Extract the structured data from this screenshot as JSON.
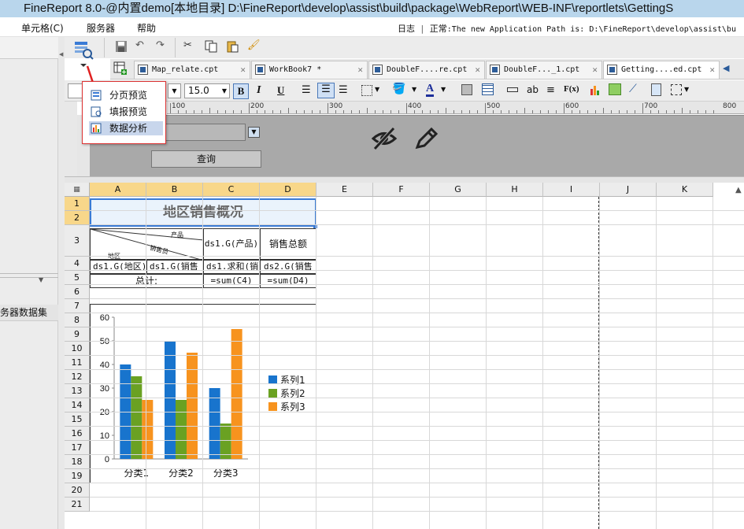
{
  "window": {
    "title": "FineReport 8.0-@内置demo[本地目录]    D:\\FineReport\\develop\\assist\\build\\package\\WebReport\\WEB-INF\\reportlets\\GettingS"
  },
  "menu": {
    "cell": "单元格(C)",
    "server": "服务器",
    "help": "帮助"
  },
  "status": {
    "log": "日志",
    "sep": "|",
    "state": "正常",
    "message": ":The new  Application Path is: D:\\FineReport\\develop\\assist\\bu"
  },
  "left_panel": {
    "dataset_label": "务器数据集"
  },
  "tabs": [
    {
      "label": "Map_relate.cpt"
    },
    {
      "label": "WorkBook7 *"
    },
    {
      "label": "DoubleF....re.cpt"
    },
    {
      "label": "DoubleF..._1.cpt"
    },
    {
      "label": "Getting....ed.cpt"
    }
  ],
  "format": {
    "font_size": "15.0",
    "bold": "B",
    "italic": "I",
    "underline": "U",
    "ab": "ab",
    "fx": "F(x)"
  },
  "ruler_ticks": [
    "100",
    "200",
    "300",
    "400",
    "500",
    "600",
    "700",
    "800"
  ],
  "preview_menu": {
    "page_preview": "分页预览",
    "fill_preview": "填报预览",
    "data_analysis": "数据分析"
  },
  "param": {
    "query_button": "查询"
  },
  "columns": [
    "A",
    "B",
    "C",
    "D",
    "E",
    "F",
    "G",
    "H",
    "I",
    "J",
    "K"
  ],
  "rows": [
    "1",
    "2",
    "3",
    "4",
    "5",
    "6",
    "7",
    "8",
    "9",
    "10",
    "11",
    "12",
    "13",
    "14",
    "15",
    "16",
    "17",
    "18",
    "19",
    "20",
    "21"
  ],
  "cells": {
    "title": "地区销售概况",
    "diag_product": "产品",
    "diag_sales": "销售员",
    "diag_region": "地区",
    "c3": "ds1.G(产品)",
    "d3": "销售总额",
    "a4": "ds1.G(地区)",
    "b4": "ds1.G(销售",
    "c4": "ds1.求和(销",
    "d4": "ds2.G(销售",
    "total": "总计:",
    "c5": "=sum(C4)",
    "d5": "=sum(D4)"
  },
  "chart_data": {
    "type": "bar",
    "categories": [
      "分类1",
      "分类2",
      "分类3"
    ],
    "series": [
      {
        "name": "系列1",
        "values": [
          40,
          50,
          30
        ],
        "color": "#1874cd"
      },
      {
        "name": "系列2",
        "values": [
          35,
          25,
          15
        ],
        "color": "#6aa122"
      },
      {
        "name": "系列3",
        "values": [
          25,
          45,
          55
        ],
        "color": "#f7931e"
      }
    ],
    "ylim": [
      0,
      60
    ],
    "yticks": [
      "0",
      "10",
      "20",
      "30",
      "40",
      "50",
      "60"
    ],
    "legend_position": "right",
    "grid": false
  }
}
